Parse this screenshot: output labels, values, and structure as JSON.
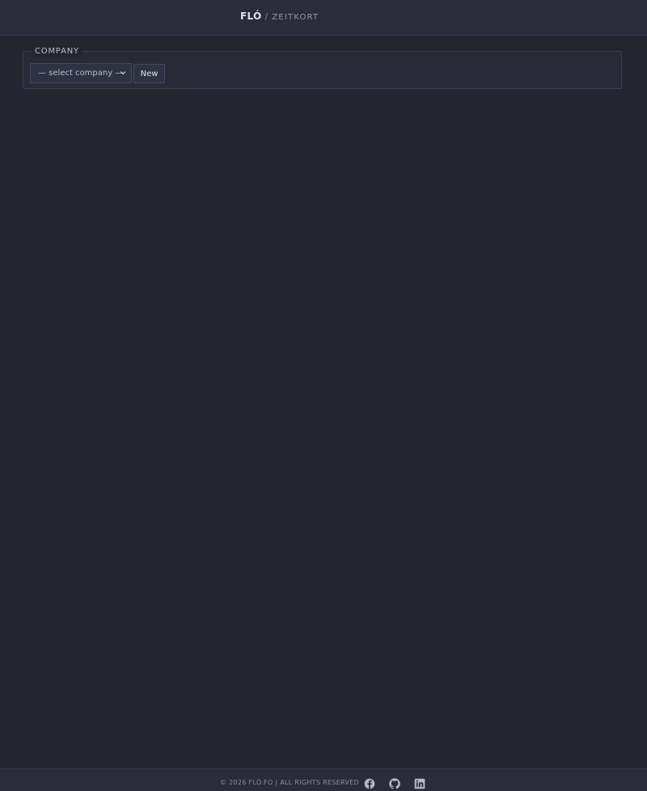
{
  "header": {
    "brand": "FLÓ",
    "separator": "/",
    "app_name": "ZEITKORT"
  },
  "company_section": {
    "legend": "COMPANY",
    "select": {
      "selected": "— select company —"
    },
    "new_button_label": "New"
  },
  "footer": {
    "copyright": "© 2026 FLÓ.FO | ALL RIGHTS RESERVED",
    "social_icons": [
      "facebook-icon",
      "github-icon",
      "linkedin-icon"
    ]
  },
  "colors": {
    "background": "#24252f",
    "header_bg": "#2a2c3b",
    "text": "#c7cad6",
    "icon": "#b4b8c8"
  }
}
